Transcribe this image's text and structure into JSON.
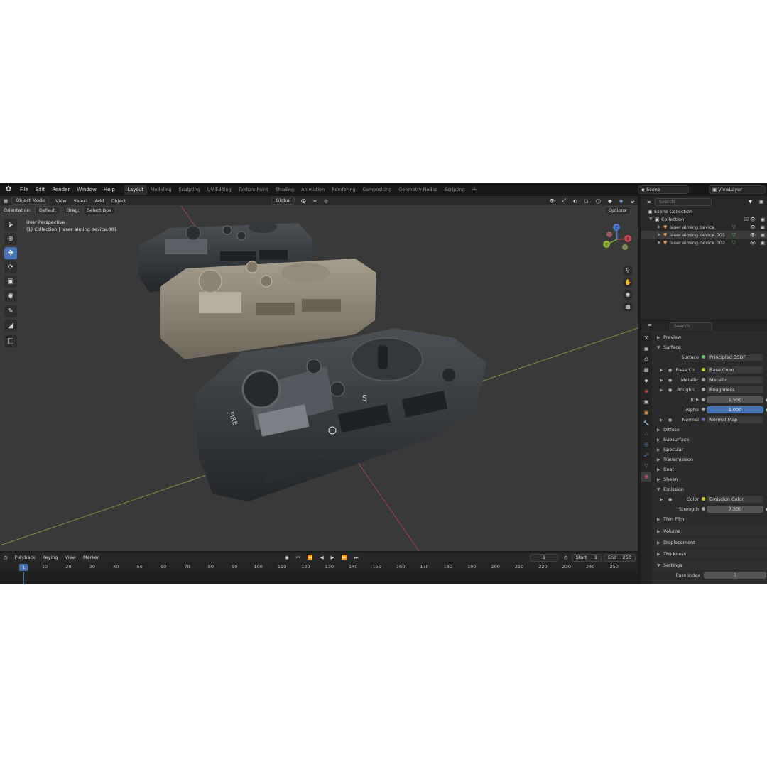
{
  "topbar": {
    "menus": [
      "File",
      "Edit",
      "Render",
      "Window",
      "Help"
    ],
    "workspaces": [
      "Layout",
      "Modeling",
      "Sculpting",
      "UV Editing",
      "Texture Paint",
      "Shading",
      "Animation",
      "Rendering",
      "Compositing",
      "Geometry Nodes",
      "Scripting"
    ],
    "active_workspace": "Layout",
    "scene": "Scene",
    "view_layer": "ViewLayer"
  },
  "viewport": {
    "mode": "Object Mode",
    "menus": [
      "View",
      "Select",
      "Add",
      "Object"
    ],
    "transform_orientation": "Global",
    "orientation_label": "Orientation:",
    "orientation_value": "Default",
    "drag_label": "Drag:",
    "drag_value": "Select Box",
    "options": "Options",
    "view_name": "User Perspective",
    "collection_info": "(1) Collection | laser aiming device.001",
    "gizmo_axes": [
      "X",
      "Y",
      "Z"
    ],
    "model_labels": [
      "FIRE",
      "S"
    ]
  },
  "timeline": {
    "menus": [
      "Playback",
      "Keying",
      "View",
      "Marker"
    ],
    "current_frame": "1",
    "start_label": "Start",
    "start": "1",
    "end_label": "End",
    "end": "250",
    "ticks": [
      "10",
      "20",
      "30",
      "40",
      "50",
      "60",
      "70",
      "80",
      "90",
      "100",
      "110",
      "120",
      "130",
      "140",
      "150",
      "160",
      "170",
      "180",
      "190",
      "200",
      "210",
      "220",
      "230",
      "240",
      "250"
    ],
    "marker": "1"
  },
  "outliner": {
    "search_placeholder": "Search",
    "root": "Scene Collection",
    "collection": "Collection",
    "objects": [
      "laser aiming device",
      "laser aiming device.001",
      "laser aiming device.002"
    ]
  },
  "properties": {
    "search_placeholder": "Search",
    "sections": {
      "preview": "Preview",
      "surface": "Surface",
      "diffuse": "Diffuse",
      "subsurface": "Subsurface",
      "specular": "Specular",
      "transmission": "Transmission",
      "coat": "Coat",
      "sheen": "Sheen",
      "emission": "Emission",
      "thin_film": "Thin Film",
      "volume": "Volume",
      "displacement": "Displacement",
      "thickness": "Thickness",
      "settings": "Settings"
    },
    "surface_fields": [
      {
        "label": "Surface",
        "value": "Principled BSDF"
      },
      {
        "label": "Base Co...",
        "value": "Base Color"
      },
      {
        "label": "Metallic",
        "value": "Metallic"
      },
      {
        "label": "Roughn...",
        "value": "Roughness"
      },
      {
        "label": "IOR",
        "value": "1.500"
      },
      {
        "label": "Alpha",
        "value": "1.000"
      },
      {
        "label": "Normal",
        "value": "Normal Map"
      }
    ],
    "emission_fields": [
      {
        "label": "Color",
        "value": "Emission Color"
      },
      {
        "label": "Strength",
        "value": "7.500"
      }
    ],
    "settings_fields": [
      {
        "label": "Pass Index",
        "value": "0"
      }
    ],
    "colors": {
      "socket_yellow": "#c7c729",
      "socket_gray": "#a1a1a1",
      "socket_purple": "#6363c7",
      "accent": "#4772b3"
    }
  }
}
